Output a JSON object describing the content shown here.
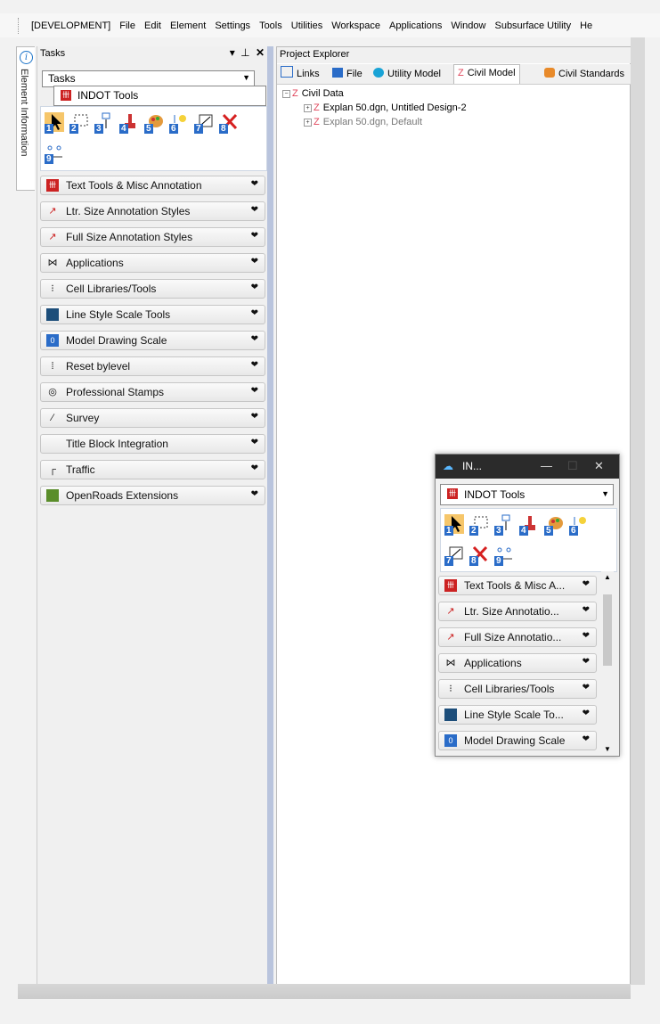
{
  "menubar": {
    "items": [
      "[DEVELOPMENT]",
      "File",
      "Edit",
      "Element",
      "Settings",
      "Tools",
      "Utilities",
      "Workspace",
      "Applications",
      "Window",
      "Subsurface Utility",
      "He"
    ]
  },
  "left_tab": {
    "label": "Element Information"
  },
  "tasks": {
    "title": "Tasks",
    "combo_value": "Tasks",
    "selected_task": "INDOT Tools",
    "tool_numbers": [
      "1",
      "2",
      "3",
      "4",
      "5",
      "6",
      "7",
      "8",
      "9"
    ],
    "categories": [
      {
        "label": "Text Tools & Misc Annotation",
        "icon": "indot-icon"
      },
      {
        "label": "Ltr. Size Annotation Styles",
        "icon": "annotation-icon"
      },
      {
        "label": "Full Size Annotation Styles",
        "icon": "annotation-icon"
      },
      {
        "label": "Applications",
        "icon": "applications-icon"
      },
      {
        "label": "Cell Libraries/Tools",
        "icon": "cell-icon"
      },
      {
        "label": "Line Style Scale Tools",
        "icon": "linestyle-icon"
      },
      {
        "label": "Model Drawing Scale",
        "icon": "scale-icon"
      },
      {
        "label": "Reset bylevel",
        "icon": "reset-icon"
      },
      {
        "label": "Professional Stamps",
        "icon": "stamp-icon"
      },
      {
        "label": "Survey",
        "icon": "survey-icon"
      },
      {
        "label": "Title Block Integration",
        "icon": ""
      },
      {
        "label": "Traffic",
        "icon": "traffic-icon"
      },
      {
        "label": "OpenRoads Extensions",
        "icon": "openroads-icon"
      }
    ]
  },
  "project_explorer": {
    "title": "Project Explorer",
    "tabs": [
      "Links",
      "File",
      "Utility Model",
      "Civil Model",
      "Civil Standards"
    ],
    "tree_root": "Civil Data",
    "tree_items": [
      "Explan 50.dgn, Untitled Design-2",
      "Explan 50.dgn, Default"
    ]
  },
  "floating": {
    "title": "IN...",
    "combo_value": "INDOT Tools",
    "tool_numbers": [
      "1",
      "2",
      "3",
      "4",
      "5",
      "6",
      "7",
      "8",
      "9"
    ],
    "categories": [
      "Text Tools & Misc A...",
      "Ltr. Size Annotatio...",
      "Full Size Annotatio...",
      "Applications",
      "Cell Libraries/Tools",
      "Line Style Scale To...",
      "Model Drawing Scale"
    ]
  },
  "colors": {
    "splitter": "#b9c4dd",
    "accent_blue": "#2a6cc8",
    "indot_red": "#cc2222",
    "title_dark": "#2b2b2b"
  }
}
